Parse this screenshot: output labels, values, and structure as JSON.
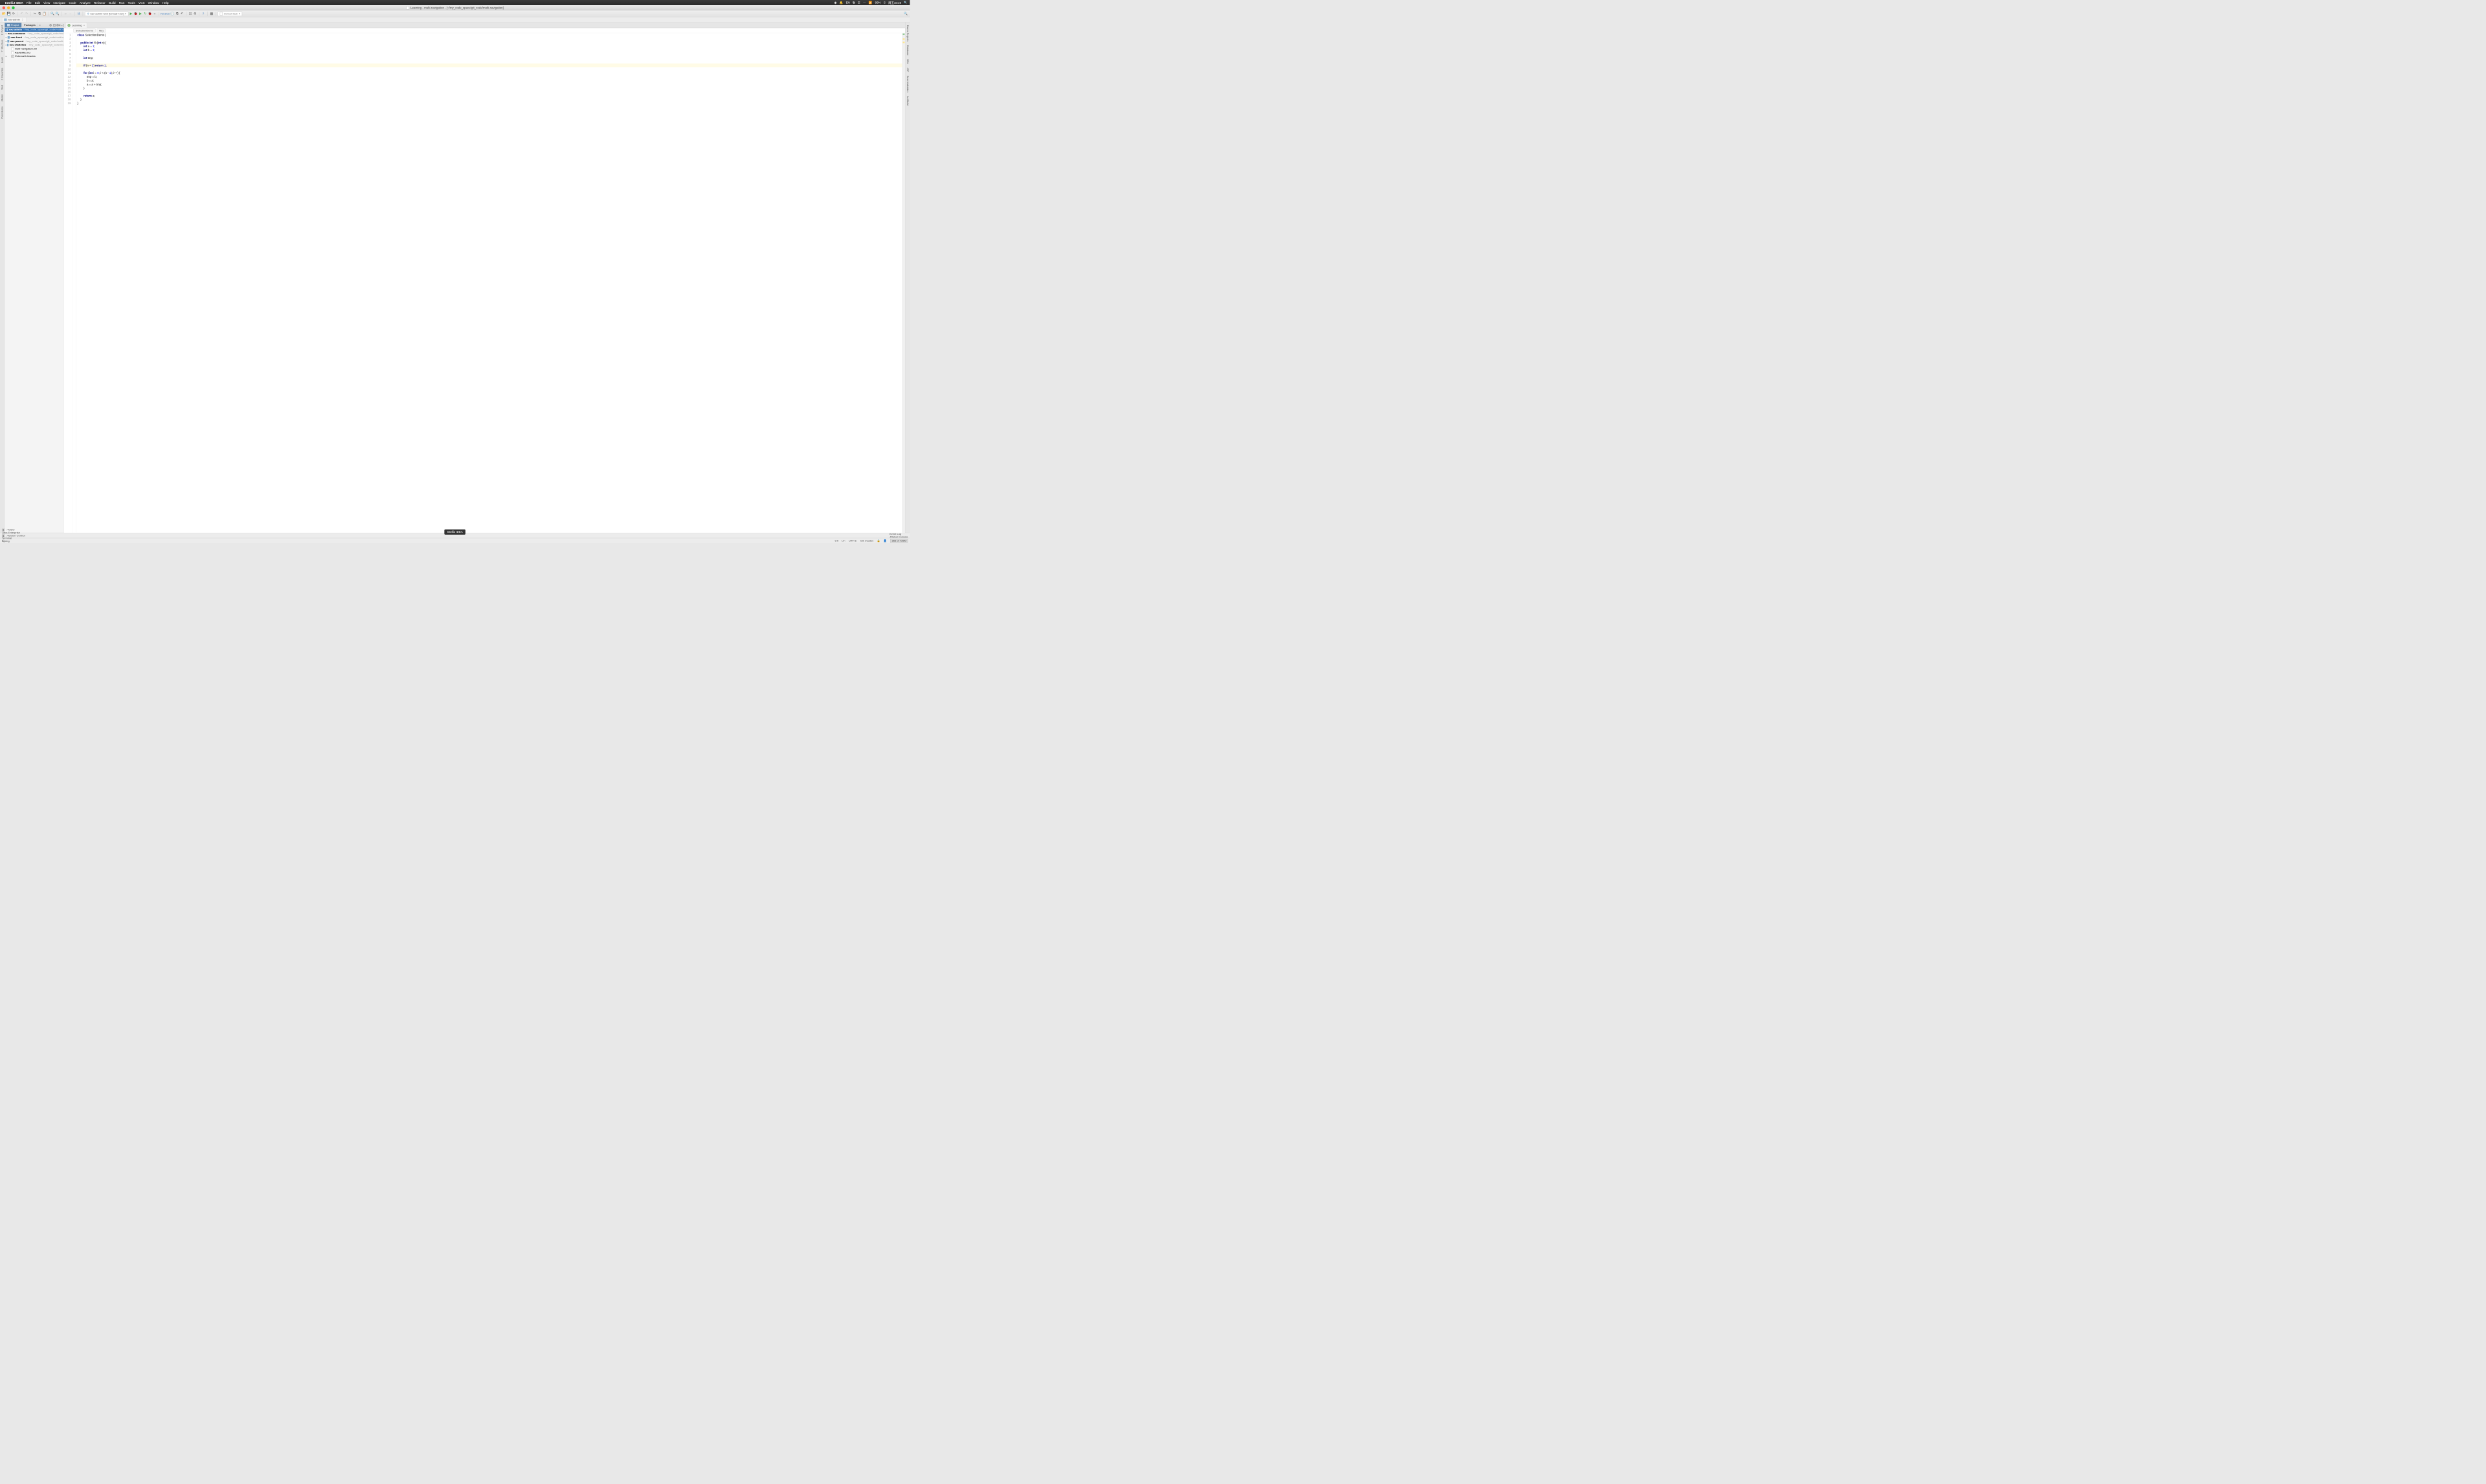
{
  "mac_menu": {
    "app": "IntelliJ IDEA",
    "items": [
      "File",
      "Edit",
      "View",
      "Navigate",
      "Code",
      "Analyze",
      "Refactor",
      "Build",
      "Run",
      "Tools",
      "VCS",
      "Window",
      "Help"
    ],
    "right": {
      "lang": "EN",
      "battery": "99%",
      "weekday_time": "周五10:19"
    }
  },
  "titlebar": {
    "text": "Learning - multi-navigation - [~/my_code_space/git_code/multi-navigation]"
  },
  "toolbar": {
    "run_config": "nav-admin-web [tomcat7:run]",
    "task_box": "Default task"
  },
  "breadcrumb": {
    "root": "nav-admin"
  },
  "project_panel": {
    "tabs": {
      "project": "Project",
      "packages": "Packages"
    },
    "items": [
      {
        "name": "nav-admin",
        "path": "~/my_code_space/git_code/multi-n",
        "selected": true,
        "kind": "module"
      },
      {
        "name": "nav-commons",
        "path": "~/my_code_space/git_code/multi",
        "kind": "module"
      },
      {
        "name": "nav-front",
        "path": "~/my_code_space/git_code/multi-n",
        "kind": "module"
      },
      {
        "name": "nav-parent",
        "path": "~/my_code_space/git_code/multi-",
        "kind": "module"
      },
      {
        "name": "nav-statistics",
        "path": "~/my_code_space/git_code/mu",
        "kind": "module"
      },
      {
        "name": "multi-navigation.iml",
        "kind": "file"
      },
      {
        "name": "README.md",
        "kind": "file"
      },
      {
        "name": "External Libraries",
        "kind": "lib"
      }
    ]
  },
  "editor": {
    "tab_label": "Learning",
    "crumbs": [
      "SelectionDemo",
      "fib()"
    ],
    "highlight_line": 9,
    "lines": [
      {
        "n": 1,
        "html": "<span class='kw'>class</span> SelectionDemo {"
      },
      {
        "n": 2,
        "html": ""
      },
      {
        "n": 3,
        "html": "    <span class='kw'>public int</span> <span class='mname'>fib</span>(<span class='kw'>int</span> n) {"
      },
      {
        "n": 4,
        "html": "        <span class='kw'>int</span> a = <span class='num'>1</span>;"
      },
      {
        "n": 5,
        "html": "        <span class='kw'>int</span> b = <span class='num'>1</span>;"
      },
      {
        "n": 6,
        "html": ""
      },
      {
        "n": 7,
        "html": "        <span class='kw'>int</span> tmp;"
      },
      {
        "n": 8,
        "html": ""
      },
      {
        "n": 9,
        "html": "        <span class='kw'>if</span> (n &lt; <span class='num'>2</span>) <span class='kw'>return</span> <span class='num'>1</span>;"
      },
      {
        "n": 10,
        "html": ""
      },
      {
        "n": 11,
        "html": "        <span class='kw'>for</span> (<span class='kw'>int</span> i = <span class='num'>0</span>; i &lt; (n - <span class='num'>1</span>); i++) {"
      },
      {
        "n": 12,
        "html": "            tmp = b;"
      },
      {
        "n": 13,
        "html": "            b = a;"
      },
      {
        "n": 14,
        "html": "            a = a + tmp;"
      },
      {
        "n": 15,
        "html": "        }"
      },
      {
        "n": 16,
        "html": ""
      },
      {
        "n": 17,
        "html": "        <span class='kw'>return</span> a;"
      },
      {
        "n": 18,
        "html": "    }"
      },
      {
        "n": 19,
        "html": "}"
      }
    ]
  },
  "left_tools": [
    "1: Project",
    "7: Structure",
    "Learn",
    "2: Favorites",
    "Web",
    "JRebel",
    "Persistence"
  ],
  "right_tools": [
    "Maven Projects",
    "Database",
    "DDL",
    "JSF",
    "Bean Validation",
    "Ant Build"
  ],
  "bottom_tools": {
    "left": [
      {
        "num": "6",
        "label": "TODO"
      },
      {
        "label": "Java Enterprise"
      },
      {
        "num": "9",
        "label": "Version Control"
      },
      {
        "label": "Terminal"
      },
      {
        "label": "Spring"
      }
    ],
    "right": [
      {
        "label": "Event Log"
      },
      {
        "label": "JRebel Console"
      }
    ]
  },
  "status": {
    "pos": "9:9",
    "le": "LF:",
    "enc": "UTF-8:",
    "git": "Git: master:",
    "mem": "266 of 725M"
  },
  "dock_tooltip": "IntelliJ IDEA"
}
